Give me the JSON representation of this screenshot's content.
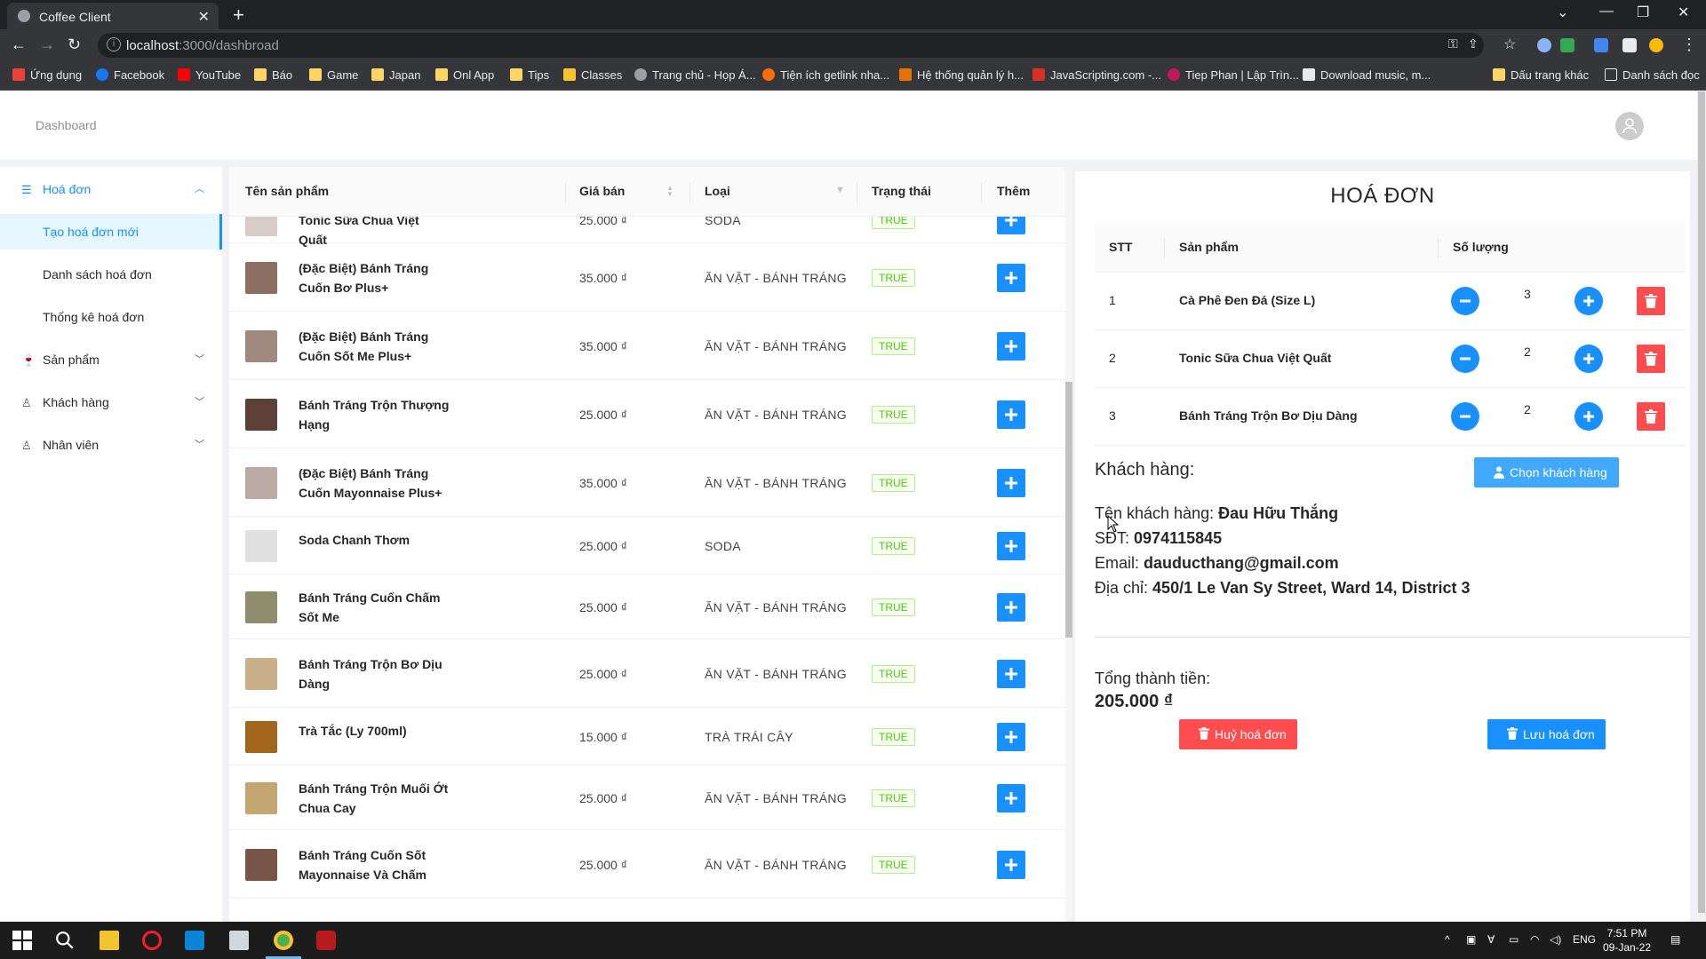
{
  "browser": {
    "tab_title": "Coffee Client",
    "url_host": "localhost",
    "url_path": ":3000/dashbroad",
    "bookmarks": [
      "Ứng dụng",
      "Facebook",
      "YouTube",
      "Báo",
      "Game",
      "Japan",
      "Onl App",
      "Tips",
      "Classes",
      "Trang chủ - Họp Á...",
      "Tiện ích getlink nha...",
      "Hệ thống quản lý h...",
      "JavaScripting.com -...",
      "Tiep Phan | Lập Trìn...",
      "Download music, m..."
    ],
    "bookmarks_right": [
      "Dấu trang khác",
      "Danh sách đọc"
    ]
  },
  "header": {
    "breadcrumb": "Dashboard"
  },
  "sidebar": {
    "invoice_menu": "Hoá đơn",
    "invoice_items": [
      "Tạo hoá đơn mới",
      "Danh sách hoá đơn",
      "Thống kê hoá đơn"
    ],
    "products": "Sản phẩm",
    "customers": "Khách hàng",
    "employees": "Nhân viên"
  },
  "product_table": {
    "columns": [
      "Tên sản phẩm",
      "Giá bán",
      "Loại",
      "Trạng thái",
      "Thêm"
    ],
    "rows": [
      {
        "name": "Tonic Sữa Chua Việt Quất",
        "price": "25.000 ₫",
        "category": "SODA",
        "status": "TRUE"
      },
      {
        "name": "(Đặc Biệt) Bánh Tráng Cuốn Bơ Plus+",
        "price": "35.000 ₫",
        "category": "ĂN VẶT - BÁNH TRÁNG",
        "status": "TRUE"
      },
      {
        "name": "(Đặc Biệt) Bánh Tráng Cuốn Sốt Me Plus+",
        "price": "35.000 ₫",
        "category": "ĂN VẶT - BÁNH TRÁNG",
        "status": "TRUE"
      },
      {
        "name": "Bánh Tráng Trộn Thượng Hạng",
        "price": "25.000 ₫",
        "category": "ĂN VẶT - BÁNH TRÁNG",
        "status": "TRUE"
      },
      {
        "name": "(Đặc Biệt) Bánh Tráng Cuốn Mayonnaise Plus+",
        "price": "35.000 ₫",
        "category": "ĂN VẶT - BÁNH TRÁNG",
        "status": "TRUE"
      },
      {
        "name": "Soda Chanh Thơm",
        "price": "25.000 ₫",
        "category": "SODA",
        "status": "TRUE"
      },
      {
        "name": "Bánh Tráng Cuốn Chấm Sốt Me",
        "price": "25.000 ₫",
        "category": "ĂN VẶT - BÁNH TRÁNG",
        "status": "TRUE"
      },
      {
        "name": "Bánh Tráng Trộn Bơ Dịu Dàng",
        "price": "25.000 ₫",
        "category": "ĂN VẶT - BÁNH TRÁNG",
        "status": "TRUE"
      },
      {
        "name": "Trà Tắc (Ly 700ml)",
        "price": "15.000 ₫",
        "category": "TRÀ TRÁI CÂY",
        "status": "TRUE"
      },
      {
        "name": "Bánh Tráng Trộn Muối Ớt Chua Cay",
        "price": "25.000 ₫",
        "category": "ĂN VẶT - BÁNH TRÁNG",
        "status": "TRUE"
      },
      {
        "name": "Bánh Tráng Cuốn Sốt Mayonnaise Và Chấm",
        "price": "25.000 ₫",
        "category": "ĂN VẶT - BÁNH TRÁNG",
        "status": "TRUE"
      }
    ]
  },
  "invoice": {
    "title": "HOÁ ĐƠN",
    "columns": [
      "STT",
      "Sản phẩm",
      "Số lượng"
    ],
    "items": [
      {
        "stt": "1",
        "product": "Cà Phê Đen Đá (Size L)",
        "qty": "3"
      },
      {
        "stt": "2",
        "product": "Tonic Sữa Chua Việt Quất",
        "qty": "2"
      },
      {
        "stt": "3",
        "product": "Bánh Tráng Trộn Bơ Dịu Dàng",
        "qty": "2"
      }
    ],
    "customer_label": "Khách hàng:",
    "choose_customer": "Chọn khách hàng",
    "customer": {
      "name_label": "Tên khách hàng:",
      "name": "Đau Hữu Thắng",
      "phone_label": "SĐT:",
      "phone": "0974115845",
      "email_label": "Email:",
      "email": "dauducthang@gmail.com",
      "address_label": "Địa chỉ:",
      "address": "450/1 Le Van Sy Street, Ward 14, District 3"
    },
    "total_label": "Tổng thành tiền:",
    "total": "205.000 ₫",
    "cancel_label": "Huỷ hoá đơn",
    "save_label": "Lưu hoá đơn"
  },
  "taskbar": {
    "lang": "ENG",
    "time": "7:51 PM",
    "date": "09-Jan-22"
  },
  "colors": {
    "primary": "#1890ff",
    "danger": "#ff4d4f",
    "success": "#52c41a"
  }
}
